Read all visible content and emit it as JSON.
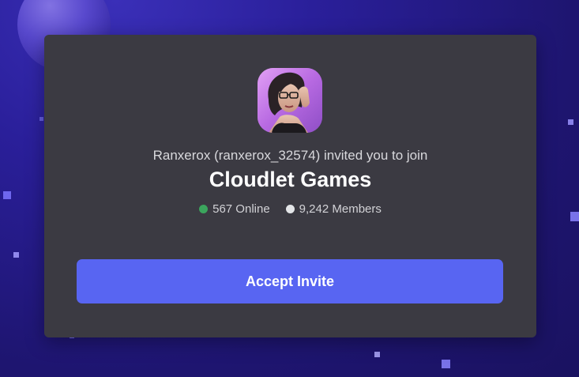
{
  "invite": {
    "inviter_text": "Ranxerox (ranxerox_32574) invited you to join",
    "server_name": "Cloudlet Games",
    "online_count": "567 Online",
    "member_count": "9,242 Members",
    "accept_label": "Accept Invite",
    "server_icon": "server-avatar-woman-glasses"
  },
  "colors": {
    "accent": "#5865f2",
    "card": "#3b3a42",
    "online_dot": "#3ba55d",
    "members_dot": "#e3e5e8"
  }
}
